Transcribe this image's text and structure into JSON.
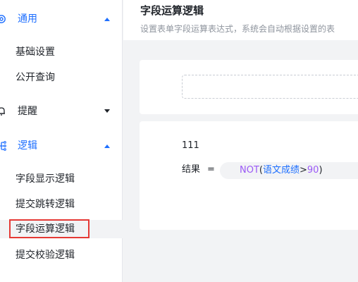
{
  "sidebar": {
    "groups": [
      {
        "label": "通用",
        "icon": "gear-icon",
        "expanded": true,
        "active": true
      },
      {
        "label": "提醒",
        "icon": "bell-icon",
        "expanded": false,
        "active": false
      },
      {
        "label": "逻辑",
        "icon": "flow-icon",
        "expanded": true,
        "active": true
      }
    ],
    "general_items": [
      "基础设置",
      "公开查询"
    ],
    "logic_items": [
      "字段显示逻辑",
      "提交跳转逻辑",
      "字段运算逻辑",
      "提交校验逻辑"
    ],
    "selected_item": "字段运算逻辑"
  },
  "header": {
    "title": "字段运算逻辑",
    "description": "设置表单字段运算表达式，系统会自动根据设置的表"
  },
  "rule": {
    "name": "111",
    "result_label": "结果",
    "equals": "=",
    "expr_fn": "NOT",
    "expr_open": "(",
    "expr_field": "语文成绩",
    "expr_op": ">",
    "expr_num": "90",
    "expr_close": ")"
  },
  "colors": {
    "accent": "#1e6fff",
    "function": "#9b59f6",
    "highlight_border": "#e53935",
    "background": "#f2f3f5"
  }
}
